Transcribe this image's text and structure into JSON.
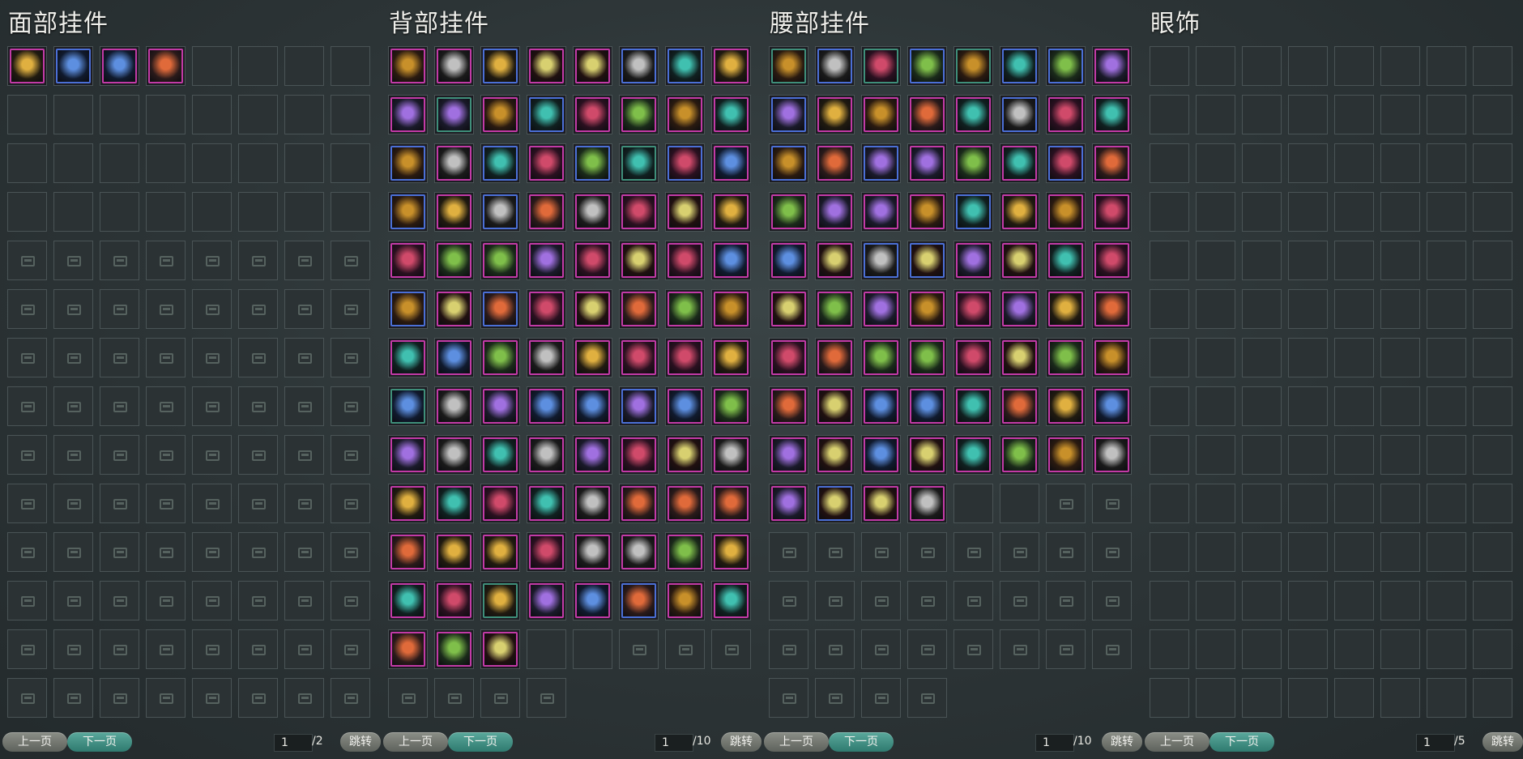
{
  "panels": [
    {
      "title": "面部挂件",
      "prev_label": "上一页",
      "next_label": "下一页",
      "page_current": "1",
      "page_total": "/2",
      "jump_label": "跳转",
      "items": [
        {
          "icon": "bird-mask-icon",
          "rarity": "purple"
        },
        {
          "icon": "cloth-veil-icon",
          "rarity": "blue"
        },
        {
          "icon": "fan-icon",
          "rarity": "purple"
        },
        {
          "icon": "silver-mask-icon",
          "rarity": "purple"
        }
      ],
      "empty_open": 28,
      "locked": 80
    },
    {
      "title": "背部挂件",
      "prev_label": "上一页",
      "next_label": "下一页",
      "page_current": "1",
      "page_total": "/10",
      "jump_label": "跳转",
      "items": [
        {
          "icon": "chest-icon",
          "rarity": "purple"
        },
        {
          "icon": "shovel-icon",
          "rarity": "purple"
        },
        {
          "icon": "gourd-icon",
          "rarity": "blue"
        },
        {
          "icon": "rocking-horse-icon",
          "rarity": "purple"
        },
        {
          "icon": "hammer-icon",
          "rarity": "purple"
        },
        {
          "icon": "blue-orb-icon",
          "rarity": "blue"
        },
        {
          "icon": "butterfly-icon",
          "rarity": "blue"
        },
        {
          "icon": "golden-fan-icon",
          "rarity": "purple"
        },
        {
          "icon": "pipa-icon",
          "rarity": "purple"
        },
        {
          "icon": "feather-icon",
          "rarity": "green"
        },
        {
          "icon": "horse-icon",
          "rarity": "purple"
        },
        {
          "icon": "drum-icon",
          "rarity": "blue"
        },
        {
          "icon": "jade-icon",
          "rarity": "purple"
        },
        {
          "icon": "sword-icon",
          "rarity": "purple"
        },
        {
          "icon": "lantern-icon",
          "rarity": "purple"
        },
        {
          "icon": "parrot-icon",
          "rarity": "purple"
        },
        {
          "icon": "box-icon",
          "rarity": "blue"
        },
        {
          "icon": "bird-icon",
          "rarity": "purple"
        },
        {
          "icon": "amber-icon",
          "rarity": "blue"
        },
        {
          "icon": "armor-icon",
          "rarity": "purple"
        },
        {
          "icon": "scroll-icon",
          "rarity": "blue"
        },
        {
          "icon": "leaf-icon",
          "rarity": "green"
        },
        {
          "icon": "vase-icon",
          "rarity": "blue"
        },
        {
          "icon": "flower-icon",
          "rarity": "purple"
        },
        {
          "icon": "crystal-icon",
          "rarity": "blue"
        },
        {
          "icon": "tent-icon",
          "rarity": "purple"
        },
        {
          "icon": "moon-rabbit-icon",
          "rarity": "blue"
        },
        {
          "icon": "urn-icon",
          "rarity": "purple"
        },
        {
          "icon": "perfume-icon",
          "rarity": "purple"
        },
        {
          "icon": "peach-icon",
          "rarity": "purple"
        },
        {
          "icon": "harp-icon",
          "rarity": "purple"
        },
        {
          "icon": "gourd-bottle-icon",
          "rarity": "purple"
        },
        {
          "icon": "cane-icon",
          "rarity": "purple"
        },
        {
          "icon": "staff-icon",
          "rarity": "purple"
        },
        {
          "icon": "umbrella-icon",
          "rarity": "purple"
        },
        {
          "icon": "frame-icon",
          "rarity": "purple"
        },
        {
          "icon": "potion-icon",
          "rarity": "purple"
        },
        {
          "icon": "guqin-icon",
          "rarity": "purple"
        },
        {
          "icon": "horse-statue-icon",
          "rarity": "purple"
        },
        {
          "icon": "horn-icon",
          "rarity": "purple"
        },
        {
          "icon": "blade-icon",
          "rarity": "blue"
        },
        {
          "icon": "sun-orb-icon",
          "rarity": "purple"
        },
        {
          "icon": "moon-orb-icon",
          "rarity": "blue"
        },
        {
          "icon": "blossom-icon",
          "rarity": "purple"
        },
        {
          "icon": "basket-icon",
          "rarity": "purple"
        },
        {
          "icon": "bouquet-icon",
          "rarity": "purple"
        },
        {
          "icon": "tree-icon",
          "rarity": "purple"
        },
        {
          "icon": "dagger-icon",
          "rarity": "purple"
        },
        {
          "icon": "skull-icon",
          "rarity": "purple"
        },
        {
          "icon": "idol-icon",
          "rarity": "purple"
        },
        {
          "icon": "mirror-icon",
          "rarity": "purple"
        },
        {
          "icon": "dragon-icon",
          "rarity": "purple"
        },
        {
          "icon": "brush-icon",
          "rarity": "purple"
        },
        {
          "icon": "phoenix-icon",
          "rarity": "purple"
        },
        {
          "icon": "gold-plate-icon",
          "rarity": "purple"
        },
        {
          "icon": "wing-icon",
          "rarity": "purple"
        },
        {
          "icon": "wheel-icon",
          "rarity": "green"
        },
        {
          "icon": "cage-icon",
          "rarity": "purple"
        },
        {
          "icon": "iris-icon",
          "rarity": "purple"
        },
        {
          "icon": "moth-icon",
          "rarity": "purple"
        },
        {
          "icon": "samurai-icon",
          "rarity": "purple"
        },
        {
          "icon": "gem-icon",
          "rarity": "blue"
        },
        {
          "icon": "bow-icon",
          "rarity": "purple"
        },
        {
          "icon": "crest-icon",
          "rarity": "purple"
        },
        {
          "icon": "white-dragon-icon",
          "rarity": "purple"
        },
        {
          "icon": "mushroom-icon",
          "rarity": "purple"
        },
        {
          "icon": "paper-fan-icon",
          "rarity": "purple"
        },
        {
          "icon": "fish-icon",
          "rarity": "purple"
        },
        {
          "icon": "robe-icon",
          "rarity": "purple"
        },
        {
          "icon": "shell-icon",
          "rarity": "purple"
        },
        {
          "icon": "gong-icon",
          "rarity": "purple"
        },
        {
          "icon": "bundle-icon",
          "rarity": "purple"
        },
        {
          "icon": "ghost-icon",
          "rarity": "purple"
        },
        {
          "icon": "purple-gem-icon",
          "rarity": "purple"
        },
        {
          "icon": "red-dragon-icon",
          "rarity": "purple"
        },
        {
          "icon": "shrine-icon",
          "rarity": "purple"
        },
        {
          "icon": "green-blade-icon",
          "rarity": "purple"
        },
        {
          "icon": "fox-icon",
          "rarity": "purple"
        },
        {
          "icon": "bamboo-icon",
          "rarity": "purple"
        },
        {
          "icon": "fire-ring-icon",
          "rarity": "purple"
        },
        {
          "icon": "cage-lantern-icon",
          "rarity": "purple"
        },
        {
          "icon": "dreamcatcher-icon",
          "rarity": "purple"
        },
        {
          "icon": "pearl-icon",
          "rarity": "purple"
        },
        {
          "icon": "scepter-icon",
          "rarity": "purple"
        },
        {
          "icon": "clock-icon",
          "rarity": "purple"
        },
        {
          "icon": "treasure-icon",
          "rarity": "purple"
        },
        {
          "icon": "rose-icon",
          "rarity": "purple"
        },
        {
          "icon": "greatsword-icon",
          "rarity": "purple"
        },
        {
          "icon": "spear-icon",
          "rarity": "purple"
        },
        {
          "icon": "chain-icon",
          "rarity": "purple"
        },
        {
          "icon": "sunflower-icon",
          "rarity": "green"
        },
        {
          "icon": "egg-icon",
          "rarity": "purple"
        },
        {
          "icon": "koi-icon",
          "rarity": "purple"
        },
        {
          "icon": "gold-scroll-icon",
          "rarity": "blue"
        },
        {
          "icon": "peacock-icon",
          "rarity": "purple"
        },
        {
          "icon": "teapot-icon",
          "rarity": "purple"
        },
        {
          "icon": "wind-chime-icon",
          "rarity": "purple"
        },
        {
          "icon": "compass-icon",
          "rarity": "purple"
        },
        {
          "icon": "blue-box-icon",
          "rarity": "purple"
        }
      ],
      "empty_open": 2,
      "locked": 7
    },
    {
      "title": "腰部挂件",
      "prev_label": "上一页",
      "next_label": "下一页",
      "page_current": "1",
      "page_total": "/10",
      "jump_label": "跳转",
      "items": [
        {
          "icon": "gourd-icon",
          "rarity": "green"
        },
        {
          "icon": "quiver-icon",
          "rarity": "blue"
        },
        {
          "icon": "horn-icon",
          "rarity": "green"
        },
        {
          "icon": "pouch-icon",
          "rarity": "blue"
        },
        {
          "icon": "lantern-icon",
          "rarity": "green"
        },
        {
          "icon": "bottle-icon",
          "rarity": "blue"
        },
        {
          "icon": "book-icon",
          "rarity": "blue"
        },
        {
          "icon": "dragon-ring-icon",
          "rarity": "purple"
        },
        {
          "icon": "drum-icon",
          "rarity": "blue"
        },
        {
          "icon": "rattle-icon",
          "rarity": "purple"
        },
        {
          "icon": "sword-icon",
          "rarity": "purple"
        },
        {
          "icon": "flute-icon",
          "rarity": "purple"
        },
        {
          "icon": "blossom-icon",
          "rarity": "purple"
        },
        {
          "icon": "candied-haws-icon",
          "rarity": "blue"
        },
        {
          "icon": "red-tassel-icon",
          "rarity": "purple"
        },
        {
          "icon": "mirror-icon",
          "rarity": "purple"
        },
        {
          "icon": "fan-icon",
          "rarity": "blue"
        },
        {
          "icon": "koi-icon",
          "rarity": "purple"
        },
        {
          "icon": "bell-icon",
          "rarity": "blue"
        },
        {
          "icon": "hairpin-icon",
          "rarity": "purple"
        },
        {
          "icon": "dragon-icon",
          "rarity": "purple"
        },
        {
          "icon": "idol-icon",
          "rarity": "purple"
        },
        {
          "icon": "bird-icon",
          "rarity": "blue"
        },
        {
          "icon": "lantern-red-icon",
          "rarity": "purple"
        },
        {
          "icon": "drum-red-icon",
          "rarity": "purple"
        },
        {
          "icon": "charm-icon",
          "rarity": "purple"
        },
        {
          "icon": "necklace-icon",
          "rarity": "purple"
        },
        {
          "icon": "dagger-icon",
          "rarity": "purple"
        },
        {
          "icon": "ingot-icon",
          "rarity": "blue"
        },
        {
          "icon": "tablet-icon",
          "rarity": "purple"
        },
        {
          "icon": "token-icon",
          "rarity": "purple"
        },
        {
          "icon": "blue-flower-icon",
          "rarity": "purple"
        },
        {
          "icon": "bow-icon",
          "rarity": "purple"
        },
        {
          "icon": "jar-icon",
          "rarity": "purple"
        },
        {
          "icon": "conch-icon",
          "rarity": "blue"
        },
        {
          "icon": "jade-ring-icon",
          "rarity": "blue"
        },
        {
          "icon": "crossbow-icon",
          "rarity": "purple"
        },
        {
          "icon": "spear-icon",
          "rarity": "purple"
        },
        {
          "icon": "brush-icon",
          "rarity": "purple"
        },
        {
          "icon": "coral-icon",
          "rarity": "purple"
        },
        {
          "icon": "bone-icon",
          "rarity": "purple"
        },
        {
          "icon": "idol-gold-icon",
          "rarity": "purple"
        },
        {
          "icon": "rosary-icon",
          "rarity": "purple"
        },
        {
          "icon": "comb-icon",
          "rarity": "purple"
        },
        {
          "icon": "skull-ring-icon",
          "rarity": "purple"
        },
        {
          "icon": "cloak-icon",
          "rarity": "purple"
        },
        {
          "icon": "trident-icon",
          "rarity": "purple"
        },
        {
          "icon": "axe-icon",
          "rarity": "purple"
        },
        {
          "icon": "white-dragon-icon",
          "rarity": "purple"
        },
        {
          "icon": "paper-fan-icon",
          "rarity": "purple"
        },
        {
          "icon": "shield-icon",
          "rarity": "purple"
        },
        {
          "icon": "red-gourd-icon",
          "rarity": "purple"
        },
        {
          "icon": "dice-icon",
          "rarity": "purple"
        },
        {
          "icon": "cat-icon",
          "rarity": "purple"
        },
        {
          "icon": "scabbard-icon",
          "rarity": "purple"
        },
        {
          "icon": "conch-blue-icon",
          "rarity": "purple"
        },
        {
          "icon": "sword-blue-icon",
          "rarity": "purple"
        },
        {
          "icon": "staff-icon",
          "rarity": "purple"
        },
        {
          "icon": "dragon-gold-icon",
          "rarity": "purple"
        },
        {
          "icon": "toad-icon",
          "rarity": "purple"
        },
        {
          "icon": "red-lantern-icon",
          "rarity": "purple"
        },
        {
          "icon": "ghost-icon",
          "rarity": "purple"
        },
        {
          "icon": "armor-icon",
          "rarity": "purple"
        },
        {
          "icon": "spiral-icon",
          "rarity": "purple"
        },
        {
          "icon": "trident-gold-icon",
          "rarity": "purple"
        },
        {
          "icon": "comb-gold-icon",
          "rarity": "purple"
        },
        {
          "icon": "shell-icon",
          "rarity": "purple"
        },
        {
          "icon": "snail-icon",
          "rarity": "purple"
        },
        {
          "icon": "pearl-icon",
          "rarity": "purple"
        },
        {
          "icon": "pot-icon",
          "rarity": "purple"
        },
        {
          "icon": "chime-icon",
          "rarity": "purple"
        },
        {
          "icon": "scythe-icon",
          "rarity": "purple"
        },
        {
          "icon": "scroll-icon",
          "rarity": "purple"
        },
        {
          "icon": "bamboo-scroll-icon",
          "rarity": "blue"
        },
        {
          "icon": "shrine-icon",
          "rarity": "purple"
        },
        {
          "icon": "crescent-icon",
          "rarity": "purple"
        }
      ],
      "empty_open": 2,
      "locked": 30
    },
    {
      "title": "眼饰",
      "prev_label": "上一页",
      "next_label": "下一页",
      "page_current": "1",
      "page_total": "/5",
      "jump_label": "跳转",
      "items": [],
      "empty_open": 112,
      "locked": 0
    }
  ]
}
